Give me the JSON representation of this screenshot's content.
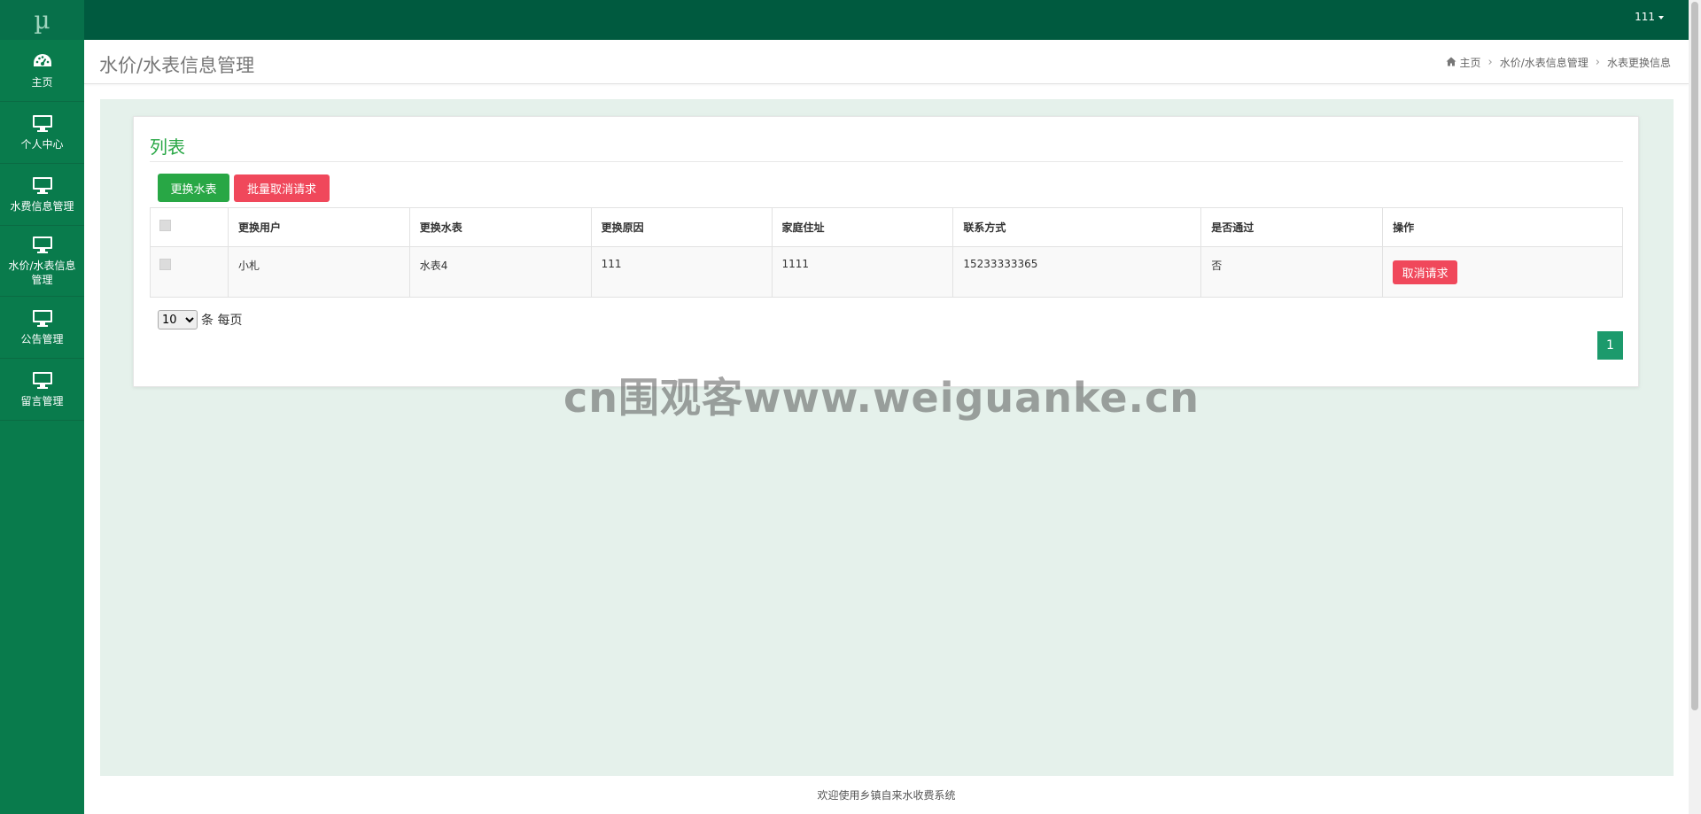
{
  "logo": "µ",
  "sidebar": {
    "items": [
      {
        "label": "主页",
        "icon": "dashboard-icon"
      },
      {
        "label": "个人中心",
        "icon": "monitor-icon"
      },
      {
        "label": "水费信息管理",
        "icon": "monitor-icon"
      },
      {
        "label": "水价/水表信息管理",
        "icon": "monitor-icon"
      },
      {
        "label": "公告管理",
        "icon": "monitor-icon"
      },
      {
        "label": "留言管理",
        "icon": "monitor-icon"
      }
    ]
  },
  "topbar": {
    "user": "111"
  },
  "header": {
    "title": "水价/水表信息管理",
    "breadcrumb": [
      "主页",
      "水价/水表信息管理",
      "水表更换信息"
    ]
  },
  "card": {
    "title": "列表",
    "buttons": {
      "replace": "更换水表",
      "batch_cancel": "批量取消请求"
    }
  },
  "table": {
    "headers": [
      "更换用户",
      "更换水表",
      "更换原因",
      "家庭住址",
      "联系方式",
      "是否通过",
      "操作"
    ],
    "rows": [
      {
        "user": "小札",
        "meter": "水表4",
        "reason": "111",
        "address": "1111",
        "phone": "15233333365",
        "approved": "否",
        "action": "取消请求"
      }
    ]
  },
  "pagination": {
    "page_size": "10",
    "page_size_suffix": "条 每页",
    "current_page": "1"
  },
  "watermark": "cn围观客www.weiguanke.cn",
  "footer": "欢迎使用乡镇自来水收费系统",
  "colors": {
    "sidebar": "#097b4c",
    "topbar": "#005a3f",
    "accent": "#28a745",
    "danger": "#f0485b"
  }
}
